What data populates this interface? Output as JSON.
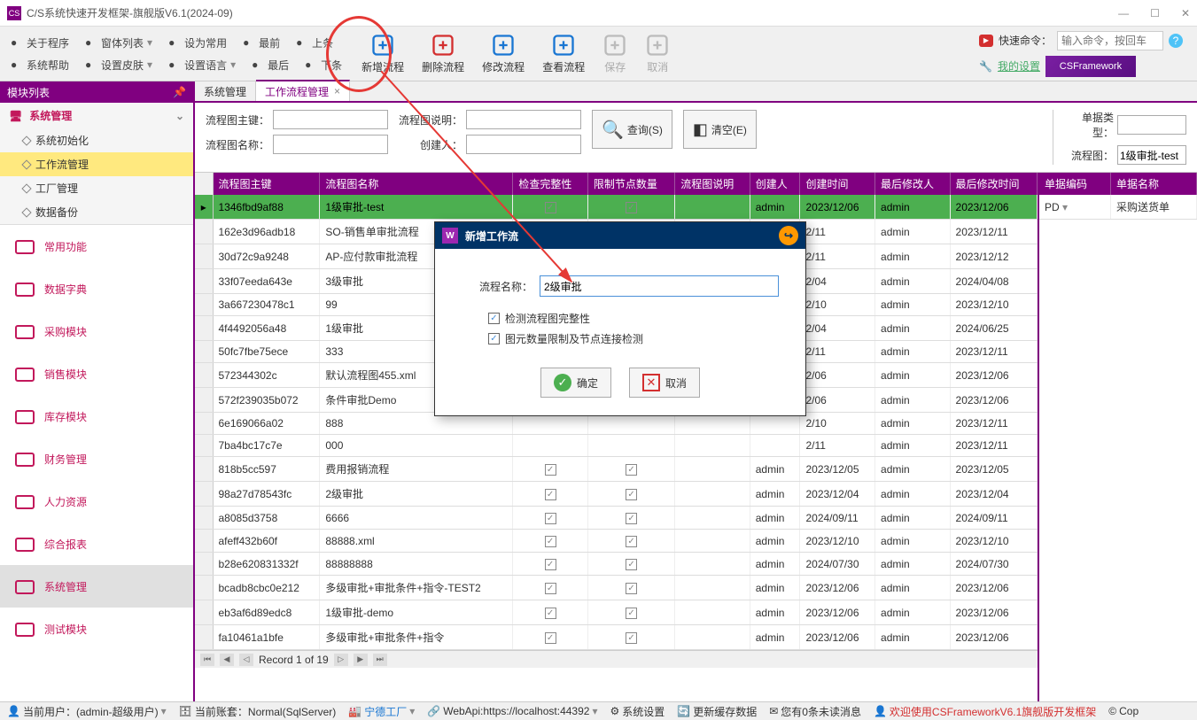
{
  "window": {
    "title": "C/S系统快速开发框架-旗舰版V6.1(2024-09)"
  },
  "menu": {
    "row1": [
      {
        "label": "关于程序",
        "icon": "info"
      },
      {
        "label": "窗体列表",
        "icon": "list",
        "dd": true
      },
      {
        "label": "设为常用",
        "icon": "star"
      },
      {
        "label": "最前",
        "icon": "first"
      },
      {
        "label": "上条",
        "icon": "prev"
      }
    ],
    "row2": [
      {
        "label": "系统帮助",
        "icon": "help"
      },
      {
        "label": "设置皮肤",
        "icon": "skin",
        "dd": true
      },
      {
        "label": "设置语言",
        "icon": "lang",
        "dd": true
      },
      {
        "label": "最后",
        "icon": "last"
      },
      {
        "label": "下条",
        "icon": "next"
      }
    ],
    "big": [
      {
        "label": "新增流程",
        "name": "add-flow",
        "color": "#1976d2"
      },
      {
        "label": "删除流程",
        "name": "delete-flow",
        "color": "#d32f2f"
      },
      {
        "label": "修改流程",
        "name": "edit-flow",
        "color": "#1976d2"
      },
      {
        "label": "查看流程",
        "name": "view-flow",
        "color": "#1976d2"
      },
      {
        "label": "保存",
        "name": "save",
        "dis": true
      },
      {
        "label": "取消",
        "name": "cancel",
        "dis": true
      }
    ],
    "quick_label": "快速命令：",
    "quick_placeholder": "输入命令，按回车",
    "settings_link": "我的设置",
    "brand": "CSFramework"
  },
  "sidebar": {
    "header": "模块列表",
    "group": {
      "title": "系统管理",
      "items": [
        {
          "label": "系统初始化"
        },
        {
          "label": "工作流管理",
          "sel": true
        },
        {
          "label": "工厂管理"
        },
        {
          "label": "数据备份"
        }
      ]
    },
    "modules": [
      {
        "label": "常用功能"
      },
      {
        "label": "数据字典"
      },
      {
        "label": "采购模块"
      },
      {
        "label": "销售模块"
      },
      {
        "label": "库存模块"
      },
      {
        "label": "财务管理"
      },
      {
        "label": "人力资源"
      },
      {
        "label": "综合报表"
      },
      {
        "label": "系统管理",
        "active": true
      },
      {
        "label": "测试模块"
      }
    ]
  },
  "tabs": [
    {
      "label": "系统管理"
    },
    {
      "label": "工作流程管理",
      "active": true,
      "closable": true
    }
  ],
  "filter": {
    "l1": "流程图主键：",
    "l2": "流程图名称：",
    "l3": "流程图说明：",
    "l4": "创建人：",
    "search": "查询(S)",
    "clear": "清空(E)",
    "r1": "单据类型：",
    "r2": "流程图：",
    "r2v": "1级审批-test"
  },
  "grid": {
    "cols": [
      "流程图主键",
      "流程图名称",
      "检查完整性",
      "限制节点数量",
      "流程图说明",
      "创建人",
      "创建时间",
      "最后修改人",
      "最后修改时间"
    ],
    "rows": [
      {
        "k": "1346fbd9af88",
        "n": "1级审批-test",
        "c1": true,
        "c2": true,
        "d": "",
        "u": "admin",
        "t1": "2023/12/06",
        "m": "admin",
        "t2": "2023/12/06",
        "sel": true
      },
      {
        "k": "162e3d96adb18",
        "n": "SO-销售单审批流程",
        "t1p": "2/11",
        "m": "admin",
        "t2": "2023/12/11"
      },
      {
        "k": "30d72c9a9248",
        "n": "AP-应付款审批流程",
        "t1p": "2/11",
        "m": "admin",
        "t2": "2023/12/12"
      },
      {
        "k": "33f07eeda643e",
        "n": "3级审批",
        "t1p": "2/04",
        "m": "admin",
        "t2": "2024/04/08"
      },
      {
        "k": "3a667230478c1",
        "n": "99",
        "t1p": "2/10",
        "m": "admin",
        "t2": "2023/12/10"
      },
      {
        "k": "4f4492056a48",
        "n": "1级审批",
        "t1p": "2/04",
        "m": "admin",
        "t2": "2024/06/25"
      },
      {
        "k": "50fc7fbe75ece",
        "n": "333",
        "t1p": "2/11",
        "m": "admin",
        "t2": "2023/12/11"
      },
      {
        "k": "572344302c",
        "n": "默认流程图455.xml",
        "t1p": "2/06",
        "m": "admin",
        "t2": "2023/12/06"
      },
      {
        "k": "572f239035b072",
        "n": "条件审批Demo",
        "t1p": "2/06",
        "m": "admin",
        "t2": "2023/12/06"
      },
      {
        "k": "6e169066a02",
        "n": "888",
        "t1p": "2/10",
        "m": "admin",
        "t2": "2023/12/11"
      },
      {
        "k": "7ba4bc17c7e",
        "n": "000",
        "t1p": "2/11",
        "m": "admin",
        "t2": "2023/12/11"
      },
      {
        "k": "818b5cc597",
        "n": "费用报销流程",
        "c1": true,
        "c2": true,
        "u": "admin",
        "t1": "2023/12/05",
        "m": "admin",
        "t2": "2023/12/05"
      },
      {
        "k": "98a27d78543fc",
        "n": "2级审批",
        "c1": true,
        "c2": true,
        "u": "admin",
        "t1": "2023/12/04",
        "m": "admin",
        "t2": "2023/12/04"
      },
      {
        "k": "a8085d3758",
        "n": "6666",
        "c1": true,
        "c2": true,
        "u": "admin",
        "t1": "2024/09/11",
        "m": "admin",
        "t2": "2024/09/11"
      },
      {
        "k": "afeff432b60f",
        "n": "88888.xml",
        "c1": true,
        "c2": true,
        "u": "admin",
        "t1": "2023/12/10",
        "m": "admin",
        "t2": "2023/12/10"
      },
      {
        "k": "b28e620831332f",
        "n": "88888888",
        "c1": true,
        "c2": true,
        "u": "admin",
        "t1": "2024/07/30",
        "m": "admin",
        "t2": "2024/07/30"
      },
      {
        "k": "bcadb8cbc0e212",
        "n": "多级审批+审批条件+指令-TEST2",
        "c1": true,
        "c2": true,
        "u": "admin",
        "t1": "2023/12/06",
        "m": "admin",
        "t2": "2023/12/06"
      },
      {
        "k": "eb3af6d89edc8",
        "n": "1级审批-demo",
        "c1": true,
        "c2": true,
        "u": "admin",
        "t1": "2023/12/06",
        "m": "admin",
        "t2": "2023/12/06"
      },
      {
        "k": "fa10461a1bfe",
        "n": "多级审批+审批条件+指令",
        "c1": true,
        "c2": true,
        "u": "admin",
        "t1": "2023/12/06",
        "m": "admin",
        "t2": "2023/12/06"
      }
    ],
    "pager": "Record 1 of 19"
  },
  "sidegrid": {
    "cols": [
      "单据编码",
      "单据名称"
    ],
    "rows": [
      {
        "c": "PD",
        "n": "采购送货单"
      }
    ]
  },
  "dialog": {
    "title": "新增工作流",
    "name_label": "流程名称：",
    "name_value": "2级审批",
    "chk1": "检测流程图完整性",
    "chk2": "图元数量限制及节点连接检测",
    "ok": "确定",
    "cancel": "取消"
  },
  "status": {
    "user": "当前用户：(admin-超级用户)",
    "acct": "当前账套：Normal(SqlServer)",
    "factory": "宁德工厂",
    "api": "WebApi:https://localhost:44392",
    "sys": "系统设置",
    "cache": "更新缓存数据",
    "msg": "您有0条未读消息",
    "welcome": "欢迎使用CSFrameworkV6.1旗舰版开发框架",
    "cop": "Cop"
  }
}
